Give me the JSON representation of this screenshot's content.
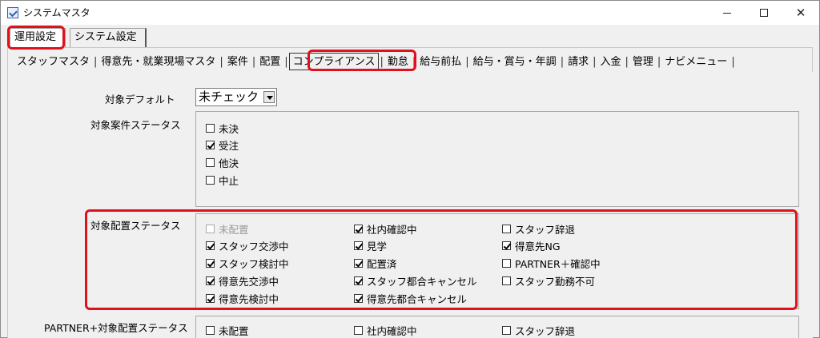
{
  "window": {
    "title": "システムマスタ",
    "minimize": "−",
    "maximize": "□",
    "close": "✕"
  },
  "outer_tabs": [
    {
      "label": "運用設定",
      "active": true
    },
    {
      "label": "システム設定",
      "active": false
    }
  ],
  "inner_tabs": [
    {
      "label": "スタッフマスタ"
    },
    {
      "label": "得意先・就業現場マスタ"
    },
    {
      "label": "案件"
    },
    {
      "label": "配置"
    },
    {
      "label": "コンプライアンス",
      "active": true
    },
    {
      "label": "勤怠"
    },
    {
      "label": "給与前払"
    },
    {
      "label": "給与・賞与・年調"
    },
    {
      "label": "請求"
    },
    {
      "label": "入金"
    },
    {
      "label": "管理"
    },
    {
      "label": "ナビメニュー"
    }
  ],
  "form": {
    "default_label": "対象デフォルト",
    "default_value": "未チェック",
    "anken_label": "対象案件ステータス",
    "anken_options": [
      {
        "label": "未決",
        "checked": false
      },
      {
        "label": "受注",
        "checked": true
      },
      {
        "label": "他決",
        "checked": false
      },
      {
        "label": "中止",
        "checked": false
      }
    ],
    "haichi_label": "対象配置ステータス",
    "haichi_options": [
      {
        "label": "未配置",
        "checked": false,
        "disabled": true
      },
      {
        "label": "スタッフ交渉中",
        "checked": true
      },
      {
        "label": "スタッフ検討中",
        "checked": true
      },
      {
        "label": "得意先交渉中",
        "checked": true
      },
      {
        "label": "得意先検討中",
        "checked": true
      },
      {
        "label": "社内確認中",
        "checked": true
      },
      {
        "label": "見学",
        "checked": true
      },
      {
        "label": "配置済",
        "checked": true
      },
      {
        "label": "スタッフ都合キャンセル",
        "checked": true
      },
      {
        "label": "得意先都合キャンセル",
        "checked": true
      },
      {
        "label": "スタッフ辞退",
        "checked": false
      },
      {
        "label": "得意先NG",
        "checked": true
      },
      {
        "label": "PARTNER＋確認中",
        "checked": false
      },
      {
        "label": "スタッフ勤務不可",
        "checked": false
      }
    ],
    "partner_label": "PARTNER+対象配置ステータス",
    "partner_options": [
      {
        "label": "未配置",
        "checked": false
      },
      {
        "label": "社内確認中",
        "checked": false
      },
      {
        "label": "スタッフ辞退",
        "checked": false
      }
    ]
  },
  "colors": {
    "highlight": "#e0101c"
  }
}
